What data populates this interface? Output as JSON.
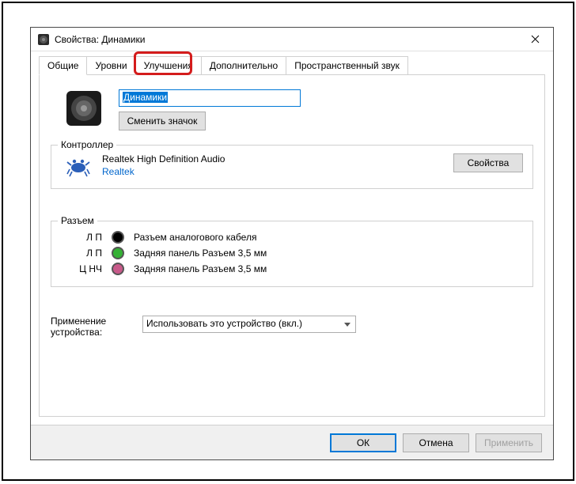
{
  "titlebar": {
    "title": "Свойства: Динамики"
  },
  "tabs": {
    "general": "Общие",
    "levels": "Уровни",
    "enhancements": "Улучшения",
    "advanced": "Дополнительно",
    "spatial": "Пространственный звук"
  },
  "device": {
    "name": "Динамики",
    "change_icon": "Сменить значок"
  },
  "controller": {
    "legend": "Контроллер",
    "name": "Realtek High Definition Audio",
    "vendor": "Realtek",
    "properties_btn": "Свойства"
  },
  "jacks": {
    "legend": "Разъем",
    "rows": [
      {
        "label": "Л П",
        "color": "#000000",
        "desc": "Разъем аналогового кабеля"
      },
      {
        "label": "Л П",
        "color": "#35b135",
        "desc": "Задняя панель Разъем 3,5 мм"
      },
      {
        "label": "Ц НЧ",
        "color": "#c85a8a",
        "desc": "Задняя панель Разъем 3,5 мм"
      }
    ]
  },
  "usage": {
    "label": "Применение устройства:",
    "selected": "Использовать это устройство (вкл.)"
  },
  "buttons": {
    "ok": "ОК",
    "cancel": "Отмена",
    "apply": "Применить"
  }
}
